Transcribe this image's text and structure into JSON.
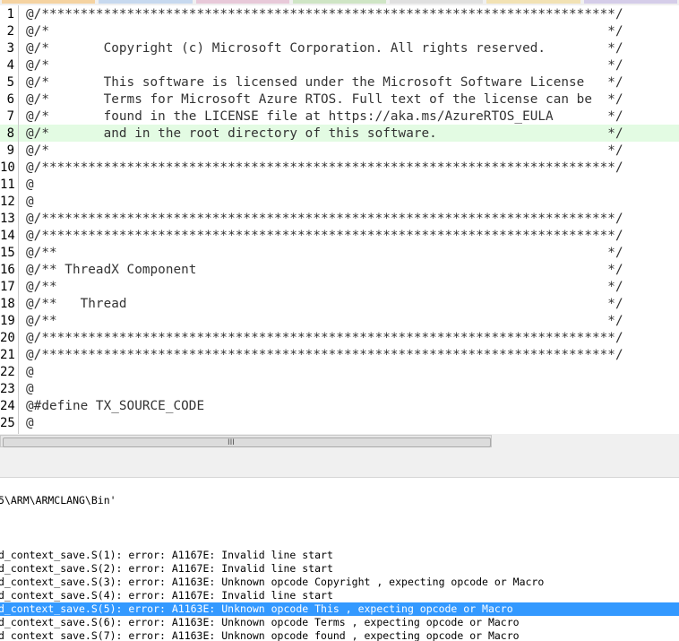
{
  "tab_colors": [
    "#f5d3a1",
    "#c7d9ef",
    "#e8c9d9",
    "#cfe5c5",
    "#e0e0e0",
    "#f2e2b4",
    "#d5cde9"
  ],
  "editor": {
    "highlight_line": 8,
    "lines": [
      {
        "n": "1",
        "text": "@/**************************************************************************/"
      },
      {
        "n": "2",
        "text": "@/*                                                                        */"
      },
      {
        "n": "3",
        "text": "@/*       Copyright (c) Microsoft Corporation. All rights reserved.        */"
      },
      {
        "n": "4",
        "text": "@/*                                                                        */"
      },
      {
        "n": "5",
        "text": "@/*       This software is licensed under the Microsoft Software License   */"
      },
      {
        "n": "6",
        "text": "@/*       Terms for Microsoft Azure RTOS. Full text of the license can be  */"
      },
      {
        "n": "7",
        "text": "@/*       found in the LICENSE file at https://aka.ms/AzureRTOS_EULA       */"
      },
      {
        "n": "8",
        "text": "@/*       and in the root directory of this software.                      */"
      },
      {
        "n": "9",
        "text": "@/*                                                                        */"
      },
      {
        "n": "10",
        "text": "@/**************************************************************************/"
      },
      {
        "n": "11",
        "text": "@"
      },
      {
        "n": "12",
        "text": "@"
      },
      {
        "n": "13",
        "text": "@/**************************************************************************/"
      },
      {
        "n": "14",
        "text": "@/**************************************************************************/"
      },
      {
        "n": "15",
        "text": "@/**                                                                       */"
      },
      {
        "n": "16",
        "text": "@/** ThreadX Component                                                     */"
      },
      {
        "n": "17",
        "text": "@/**                                                                       */"
      },
      {
        "n": "18",
        "text": "@/**   Thread                                                              */"
      },
      {
        "n": "19",
        "text": "@/**                                                                       */"
      },
      {
        "n": "20",
        "text": "@/**************************************************************************/"
      },
      {
        "n": "21",
        "text": "@/**************************************************************************/"
      },
      {
        "n": "22",
        "text": "@"
      },
      {
        "n": "23",
        "text": "@"
      },
      {
        "n": "24",
        "text": "@#define TX_SOURCE_CODE"
      },
      {
        "n": "25",
        "text": "@"
      }
    ]
  },
  "scrollbar": {
    "grip": "III"
  },
  "output": {
    "selected_index": 7,
    "lines": [
      "5\\ARM\\ARMCLANG\\Bin'",
      "",
      "",
      "d_context_save.S(1): error: A1167E: Invalid line start",
      "d_context_save.S(2): error: A1167E: Invalid line start",
      "d_context_save.S(3): error: A1163E: Unknown opcode Copyright , expecting opcode or Macro",
      "d_context_save.S(4): error: A1167E: Invalid line start",
      "d_context_save.S(5): error: A1163E: Unknown opcode This , expecting opcode or Macro",
      "d_context_save.S(6): error: A1163E: Unknown opcode Terms , expecting opcode or Macro",
      "d_context_save.S(7): error: A1163E: Unknown opcode found , expecting opcode or Macro"
    ]
  }
}
